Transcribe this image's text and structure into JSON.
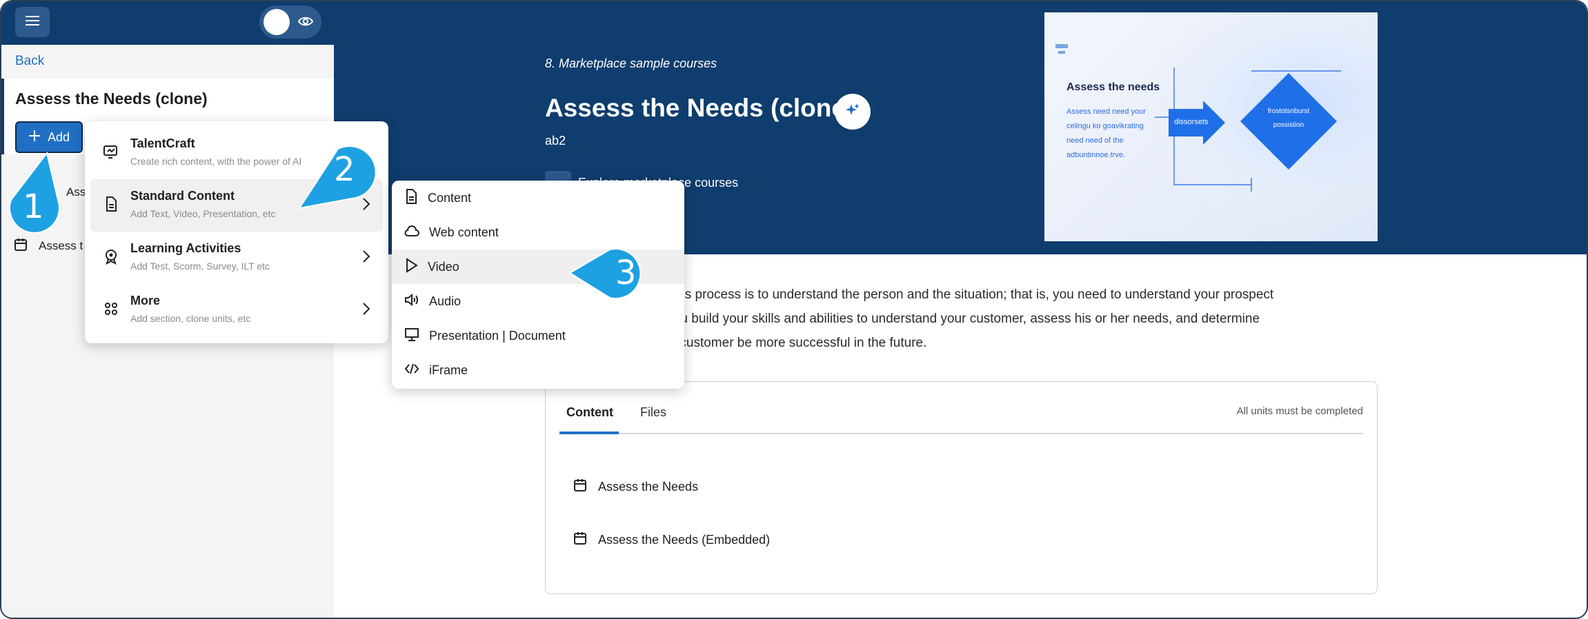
{
  "sidebar": {
    "menu_icon": "hamburger-icon",
    "visibility_icon": "eye-icon",
    "back": "Back",
    "course_title": "Assess the Needs (clone)",
    "add_label": "Add",
    "units": [
      {
        "label": "Assess t",
        "icon": "unit-icon"
      },
      {
        "label": "Assess t",
        "icon": "calendar-icon"
      }
    ]
  },
  "header": {
    "breadcrumb": "8. Marketplace sample courses",
    "title": "Assess the Needs (clone)",
    "code": "ab2",
    "category": "Explore marketplace courses",
    "thumbnail": {
      "heading": "Assess the needs",
      "lines": [
        "Assess need need your",
        "celingu ko goavikrating",
        "need need of the",
        "adbuntinnoe.trve."
      ],
      "arrow_text": "dissorsets",
      "diamond_text": [
        "frostotsnburst",
        "possistion"
      ]
    }
  },
  "description": {
    "line1": "The first step of the sales process is to understand the person and the situation; that is, you need to understand your prospect",
    "line2": "This course will help you build your skills and abilities to understand your customer, assess his or her needs, and determine",
    "line3": "how you can help your customer be more successful in the future."
  },
  "content_card": {
    "tabs": [
      {
        "label": "Content",
        "active": true
      },
      {
        "label": "Files",
        "active": false
      }
    ],
    "requirement": "All units must be completed",
    "units": [
      {
        "label": "Assess the Needs",
        "icon": "calendar-icon"
      },
      {
        "label": "Assess the Needs (Embedded)",
        "icon": "calendar-icon"
      }
    ]
  },
  "add_menu": {
    "items": [
      {
        "label": "TalentCraft",
        "sub": "Create rich content, with the power of AI",
        "icon": "talentcraft-icon",
        "has_submenu": false
      },
      {
        "label": "Standard Content",
        "sub": "Add Text, Video, Presentation, etc",
        "icon": "document-icon",
        "has_submenu": true,
        "active": true
      },
      {
        "label": "Learning Activities",
        "sub": "Add Test, Scorm, Survey, ILT etc",
        "icon": "activity-icon",
        "has_submenu": true
      },
      {
        "label": "More",
        "sub": "Add section, clone units, etc",
        "icon": "more-icon",
        "has_submenu": true
      }
    ]
  },
  "submenu": {
    "items": [
      {
        "label": "Content",
        "icon": "document-icon"
      },
      {
        "label": "Web content",
        "icon": "cloud-icon"
      },
      {
        "label": "Video",
        "icon": "play-icon",
        "active": true
      },
      {
        "label": "Audio",
        "icon": "speaker-icon"
      },
      {
        "label": "Presentation | Document",
        "icon": "presentation-icon"
      },
      {
        "label": "iFrame",
        "icon": "code-icon"
      }
    ]
  },
  "callouts": [
    "1",
    "2",
    "3"
  ],
  "colors": {
    "navy": "#0f3d6e",
    "accent": "#1f6fc4",
    "callout": "#1da1e2"
  }
}
